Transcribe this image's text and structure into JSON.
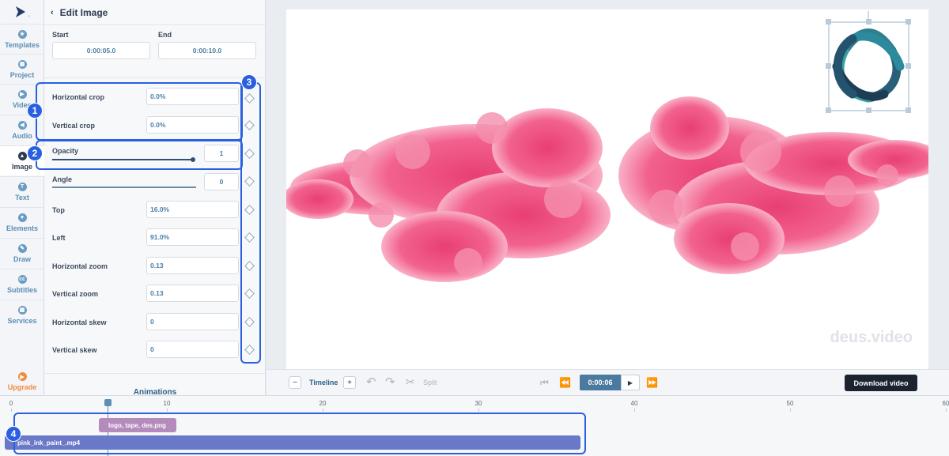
{
  "rail": {
    "items": [
      {
        "label": "Templates",
        "icon": "star-icon",
        "glyph": "★"
      },
      {
        "label": "Project",
        "icon": "grid-icon",
        "glyph": "▦"
      },
      {
        "label": "Video",
        "icon": "play-icon",
        "glyph": "▶"
      },
      {
        "label": "Audio",
        "icon": "audio-icon",
        "glyph": "◀"
      },
      {
        "label": "Image",
        "icon": "image-icon",
        "glyph": "▲"
      },
      {
        "label": "Text",
        "icon": "text-icon",
        "glyph": "T"
      },
      {
        "label": "Elements",
        "icon": "elements-icon",
        "glyph": "▾"
      },
      {
        "label": "Draw",
        "icon": "pencil-icon",
        "glyph": "✎"
      },
      {
        "label": "Subtitles",
        "icon": "cc-icon",
        "glyph": "cc"
      },
      {
        "label": "Services",
        "icon": "services-icon",
        "glyph": "▦"
      }
    ],
    "upgrade": {
      "label": "Upgrade",
      "glyph": "▶"
    }
  },
  "panel": {
    "title": "Edit Image",
    "start_label": "Start",
    "start_value": "0:00:05.0",
    "end_label": "End",
    "end_value": "0:00:10.0",
    "fields": {
      "hcrop": {
        "label": "Horizontal crop",
        "value": "0.0%"
      },
      "vcrop": {
        "label": "Vertical crop",
        "value": "0.0%"
      },
      "opacity": {
        "label": "Opacity",
        "value": "1"
      },
      "angle": {
        "label": "Angle",
        "value": "0"
      },
      "top": {
        "label": "Top",
        "value": "16.0%"
      },
      "left": {
        "label": "Left",
        "value": "91.0%"
      },
      "hzoom": {
        "label": "Horizontal zoom",
        "value": "0.13"
      },
      "vzoom": {
        "label": "Vertical zoom",
        "value": "0.13"
      },
      "hskew": {
        "label": "Horizontal skew",
        "value": "0"
      },
      "vskew": {
        "label": "Vertical skew",
        "value": "0"
      }
    },
    "animations_label": "Animations"
  },
  "badges": [
    "1",
    "2",
    "3",
    "4"
  ],
  "preview": {
    "watermark": "deus.video"
  },
  "toolbar": {
    "timeline_label": "Timeline",
    "split_label": "Split",
    "timecode": "0:00:06",
    "download_label": "Download video"
  },
  "timeline": {
    "ticks": [
      "0",
      "10",
      "20",
      "30",
      "40",
      "50",
      "60"
    ],
    "image_clip": "logo, tape, des.png",
    "video_clip": "pink_ink_paint_.mp4"
  }
}
